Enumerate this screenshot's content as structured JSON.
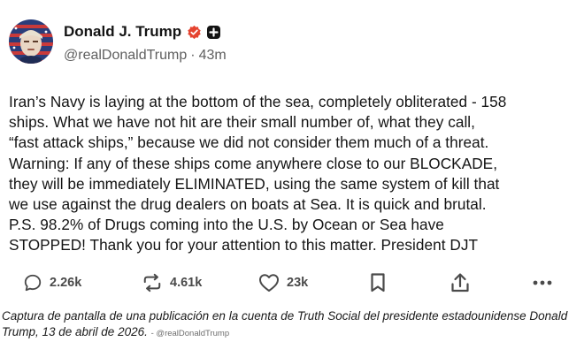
{
  "post": {
    "author": {
      "display_name": "Donald J. Trump",
      "handle": "@realDonaldTrump",
      "separator": "·",
      "time_ago": "43m",
      "verified_icon": "verified-badge-icon",
      "plus_icon": "plus-badge-icon",
      "accent_color": "#e5432f"
    },
    "text": "Iran’s Navy is laying at the bottom of the sea, completely obliterated - 158\nships. What we have not hit are their small number of, what they call,\n“fast attack ships,” because we did not consider them much of a threat.\nWarning: If any of these ships come anywhere close to our BLOCKADE,\nthey will be immediately ELIMINATED, using the same system of kill that\nwe use against the drug dealers on boats at Sea. It is quick and brutal.\nP.S. 98.2% of Drugs coming into the U.S. by Ocean or Sea have\nSTOPPED! Thank you for your attention to this matter. President DJT",
    "actions": {
      "replies": {
        "icon": "reply-icon",
        "count": "2.26k"
      },
      "retruths": {
        "icon": "retruth-icon",
        "count": "4.61k"
      },
      "likes": {
        "icon": "heart-icon",
        "count": "23k"
      },
      "bookmark": {
        "icon": "bookmark-icon"
      },
      "share": {
        "icon": "share-icon"
      },
      "more": {
        "icon": "more-icon"
      }
    }
  },
  "caption": {
    "text": "Captura de pantalla de una publicación en la cuenta de Truth Social del presidente estadounidense Donald Trump, 13 de abril de 2026.",
    "credit": "- @realDonaldTrump"
  }
}
